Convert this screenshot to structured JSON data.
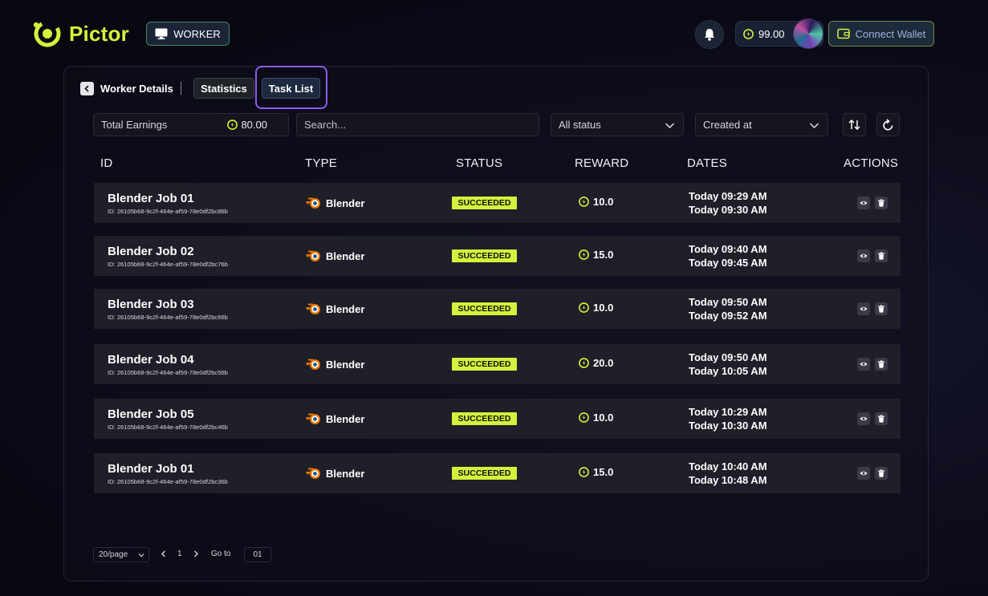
{
  "app": {
    "name": "Pictor",
    "mode_badge": "WORKER"
  },
  "header": {
    "balance": "99.00",
    "connect_label": "Connect Wallet"
  },
  "page": {
    "title": "Worker Details",
    "tabs": [
      {
        "label": "Statistics",
        "active": false
      },
      {
        "label": "Task List",
        "active": true
      }
    ]
  },
  "filters": {
    "earnings_label": "Total Earnings",
    "earnings_value": "80.00",
    "search_placeholder": "Search...",
    "status_selected": "All status",
    "sort_selected": "Created at"
  },
  "table": {
    "columns": [
      "ID",
      "TYPE",
      "STATUS",
      "REWARD",
      "DATES",
      "ACTIONS"
    ],
    "rows": [
      {
        "name": "Blender Job 01",
        "id": "ID: 26105b68-9c2f-464e-af59-78e0df2bc86b",
        "type": "Blender",
        "status": "SUCCEEDED",
        "reward": "10.0",
        "start": "Today 09:29 AM",
        "end": "Today 09:30 AM"
      },
      {
        "name": "Blender Job 02",
        "id": "ID: 26105b68-9c2f-464e-af59-78e0df2bc76b",
        "type": "Blender",
        "status": "SUCCEEDED",
        "reward": "15.0",
        "start": "Today 09:40 AM",
        "end": "Today 09:45 AM"
      },
      {
        "name": "Blender Job 03",
        "id": "ID: 26105b68-9c2f-464e-af59-78e0df2bc66b",
        "type": "Blender",
        "status": "SUCCEEDED",
        "reward": "10.0",
        "start": "Today 09:50 AM",
        "end": "Today 09:52 AM"
      },
      {
        "name": "Blender Job 04",
        "id": "ID: 26105b68-9c2f-464e-af59-78e0df2bc56b",
        "type": "Blender",
        "status": "SUCCEEDED",
        "reward": "20.0",
        "start": "Today 09:50 AM",
        "end": "Today 10:05 AM"
      },
      {
        "name": "Blender Job 05",
        "id": "ID: 26105b68-9c2f-464e-af59-78e0df2bc46b",
        "type": "Blender",
        "status": "SUCCEEDED",
        "reward": "10.0",
        "start": "Today 10:29 AM",
        "end": "Today 10:30 AM"
      },
      {
        "name": "Blender Job 01",
        "id": "ID: 26105b68-9c2f-464e-af59-78e0df2bc36b",
        "type": "Blender",
        "status": "SUCCEEDED",
        "reward": "15.0",
        "start": "Today 10:40 AM",
        "end": "Today 10:48 AM"
      }
    ]
  },
  "pagination": {
    "page_size": "20/page",
    "current_page": "1",
    "goto_label": "Go to",
    "goto_value": "01"
  },
  "icons": {
    "logo": "pictor-logo-icon",
    "worker": "monitor-icon",
    "notifications": "bell-icon",
    "coin": "coin-icon",
    "wallet": "wallet-icon",
    "back": "chevron-left-icon",
    "dropdown": "chevron-down-icon",
    "sort": "sort-arrows-icon",
    "refresh": "refresh-icon",
    "blender": "blender-icon",
    "view": "eye-icon",
    "delete": "trash-icon"
  },
  "colors": {
    "accent": "#d4f23c",
    "tab_highlight": "#8a5cf0",
    "row_bg": "#1e1f28",
    "page_bg": "#0b0b1a"
  }
}
